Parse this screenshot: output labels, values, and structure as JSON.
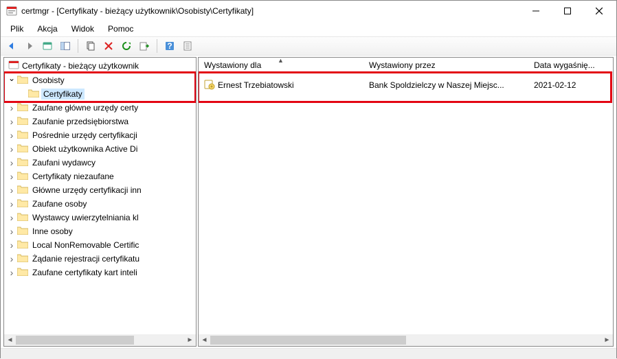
{
  "window": {
    "title": "certmgr - [Certyfikaty - bieżący użytkownik\\Osobisty\\Certyfikaty]"
  },
  "menu": {
    "file": "Plik",
    "action": "Akcja",
    "view": "Widok",
    "help": "Pomoc"
  },
  "tree": {
    "root": "Certyfikaty - bieżący użytkownik",
    "items": [
      {
        "label": "Osobisty",
        "expanded": true,
        "children": [
          {
            "label": "Certyfikaty",
            "selected": true
          }
        ]
      },
      {
        "label": "Zaufane główne urzędy certy"
      },
      {
        "label": "Zaufanie przedsiębiorstwa"
      },
      {
        "label": "Pośrednie urzędy certyfikacji"
      },
      {
        "label": "Obiekt użytkownika Active Di"
      },
      {
        "label": "Zaufani wydawcy"
      },
      {
        "label": "Certyfikaty niezaufane"
      },
      {
        "label": "Główne urzędy certyfikacji inn"
      },
      {
        "label": "Zaufane osoby"
      },
      {
        "label": "Wystawcy uwierzytelniania kl"
      },
      {
        "label": "Inne osoby"
      },
      {
        "label": "Local NonRemovable Certific"
      },
      {
        "label": "Żądanie rejestracji certyfikatu"
      },
      {
        "label": "Zaufane certyfikaty kart inteli"
      }
    ]
  },
  "list": {
    "columns": {
      "issued_to": "Wystawiony dla",
      "issued_by": "Wystawiony przez",
      "expiry": "Data wygaśnię..."
    },
    "rows": [
      {
        "issued_to": "Ernest Trzebiatowski",
        "issued_by": "Bank Spoldzielczy w Naszej Miejsc...",
        "expiry": "2021-02-12"
      }
    ]
  }
}
